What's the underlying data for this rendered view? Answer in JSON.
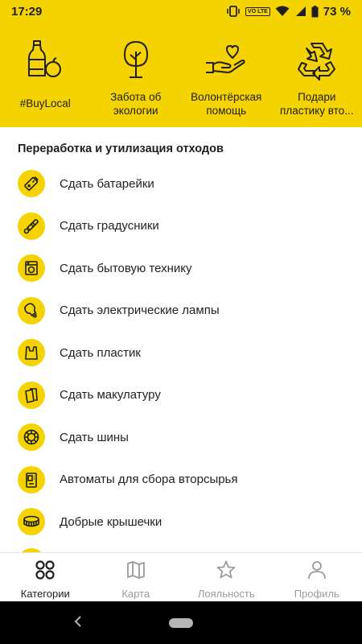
{
  "status_bar": {
    "time": "17:29",
    "network_label": "VO LTE",
    "battery_text": "73 %"
  },
  "categories": [
    {
      "label": "#BuyLocal",
      "icon": "bottle-apple-icon"
    },
    {
      "label_line1": "Забота об",
      "label_line2": "экологии",
      "icon": "tree-icon"
    },
    {
      "label_line1": "Волонтёрская",
      "label_line2": "помощь",
      "icon": "hand-heart-icon"
    },
    {
      "label_line1": "Подари",
      "label_line2": "пластику вто...",
      "icon": "recycle-icon"
    }
  ],
  "section": {
    "title": "Переработка и утилизация отходов"
  },
  "items": [
    {
      "label": "Сдать батарейки",
      "icon": "battery-icon"
    },
    {
      "label": "Сдать градусники",
      "icon": "thermometer-icon"
    },
    {
      "label": "Сдать бытовую технику",
      "icon": "washing-machine-icon"
    },
    {
      "label": "Сдать электрические лампы",
      "icon": "lightbulb-icon"
    },
    {
      "label": "Сдать пластик",
      "icon": "plastic-bag-icon"
    },
    {
      "label": "Сдать макулатуру",
      "icon": "paper-icon"
    },
    {
      "label": "Сдать шины",
      "icon": "tire-icon"
    },
    {
      "label": "Автоматы для сбора вторсырья",
      "icon": "vending-machine-icon"
    },
    {
      "label": "Добрые крышечки",
      "icon": "bottle-cap-icon"
    }
  ],
  "bottom_nav": {
    "tabs": [
      {
        "label": "Категории",
        "icon": "categories-icon",
        "active": true
      },
      {
        "label": "Карта",
        "icon": "map-icon",
        "active": false
      },
      {
        "label": "Лояльность",
        "icon": "star-icon",
        "active": false
      },
      {
        "label": "Профиль",
        "icon": "profile-icon",
        "active": false
      }
    ]
  },
  "colors": {
    "accent": "#f4d300",
    "text": "#1f1f1f",
    "inactive": "#9a9a9a"
  }
}
